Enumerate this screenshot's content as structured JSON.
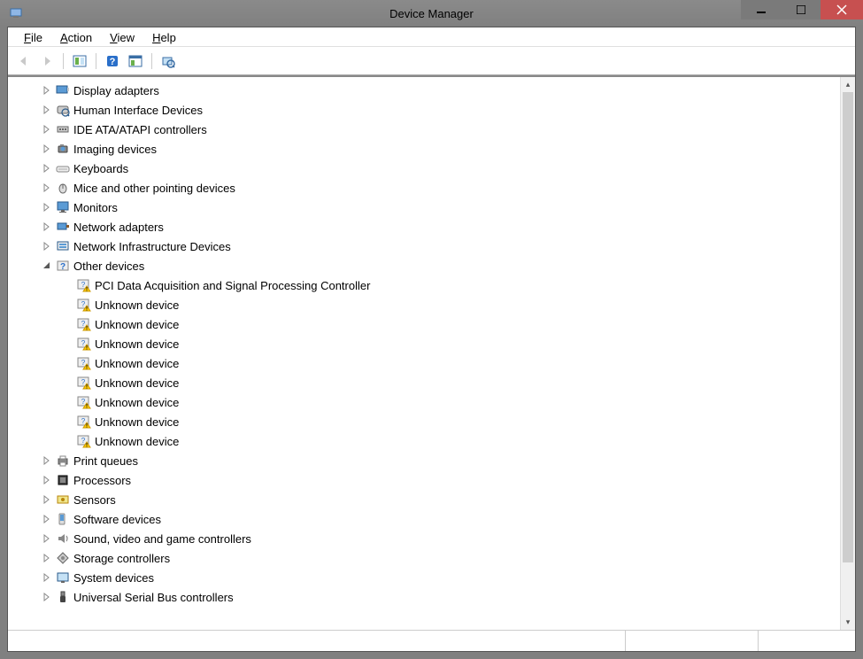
{
  "title": "Device Manager",
  "menus": {
    "file": "File",
    "action": "Action",
    "view": "View",
    "help": "Help"
  },
  "tree": [
    {
      "label": "Display adapters",
      "icon": "display-adapter"
    },
    {
      "label": "Human Interface Devices",
      "icon": "hid"
    },
    {
      "label": "IDE ATA/ATAPI controllers",
      "icon": "ide"
    },
    {
      "label": "Imaging devices",
      "icon": "imaging"
    },
    {
      "label": "Keyboards",
      "icon": "keyboard"
    },
    {
      "label": "Mice and other pointing devices",
      "icon": "mouse"
    },
    {
      "label": "Monitors",
      "icon": "monitor"
    },
    {
      "label": "Network adapters",
      "icon": "network"
    },
    {
      "label": "Network Infrastructure Devices",
      "icon": "network-infra"
    },
    {
      "label": "Other devices",
      "icon": "other",
      "expanded": true,
      "children": [
        {
          "label": "PCI Data Acquisition and Signal Processing Controller"
        },
        {
          "label": "Unknown device"
        },
        {
          "label": "Unknown device"
        },
        {
          "label": "Unknown device"
        },
        {
          "label": "Unknown device"
        },
        {
          "label": "Unknown device"
        },
        {
          "label": "Unknown device"
        },
        {
          "label": "Unknown device"
        },
        {
          "label": "Unknown device"
        }
      ]
    },
    {
      "label": "Print queues",
      "icon": "printer"
    },
    {
      "label": "Processors",
      "icon": "processor"
    },
    {
      "label": "Sensors",
      "icon": "sensor"
    },
    {
      "label": "Software devices",
      "icon": "software"
    },
    {
      "label": "Sound, video and game controllers",
      "icon": "sound"
    },
    {
      "label": "Storage controllers",
      "icon": "storage"
    },
    {
      "label": "System devices",
      "icon": "system"
    },
    {
      "label": "Universal Serial Bus controllers",
      "icon": "usb"
    }
  ]
}
